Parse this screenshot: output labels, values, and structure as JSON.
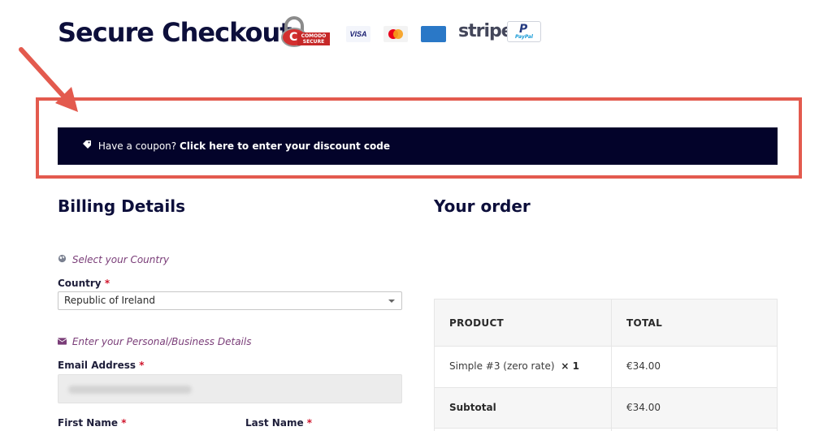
{
  "header": {
    "title": "Secure Checkout",
    "comodo_letter": "C",
    "comodo_label": "COMODO SECURE",
    "visa_label": "VISA",
    "stripe_label": "stripe",
    "paypal_letter": "P",
    "paypal_label": "PayPal"
  },
  "annotation": {
    "highlight_color": "#e35a4e"
  },
  "coupon": {
    "prefix": "Have a coupon? ",
    "link_text": "Click here to enter your discount code",
    "icon": "tag-icon",
    "background": "#03032a"
  },
  "billing": {
    "heading": "Billing Details",
    "country_hint": "Select your Country",
    "country_hint_icon": "globe-icon",
    "country_label": "Country",
    "country_value": "Republic of Ireland",
    "personal_hint": "Enter your Personal/Business Details",
    "personal_hint_icon": "envelope-icon",
    "email_label": "Email Address",
    "first_name_label": "First Name",
    "last_name_label": "Last Name",
    "required_marker": "*"
  },
  "order": {
    "heading": "Your order",
    "columns": [
      "PRODUCT",
      "TOTAL"
    ],
    "items": [
      {
        "name": "Simple #3 (zero rate)",
        "qty": "× 1",
        "total": "€34.00"
      }
    ],
    "subtotal_label": "Subtotal",
    "subtotal_value": "€34.00"
  }
}
